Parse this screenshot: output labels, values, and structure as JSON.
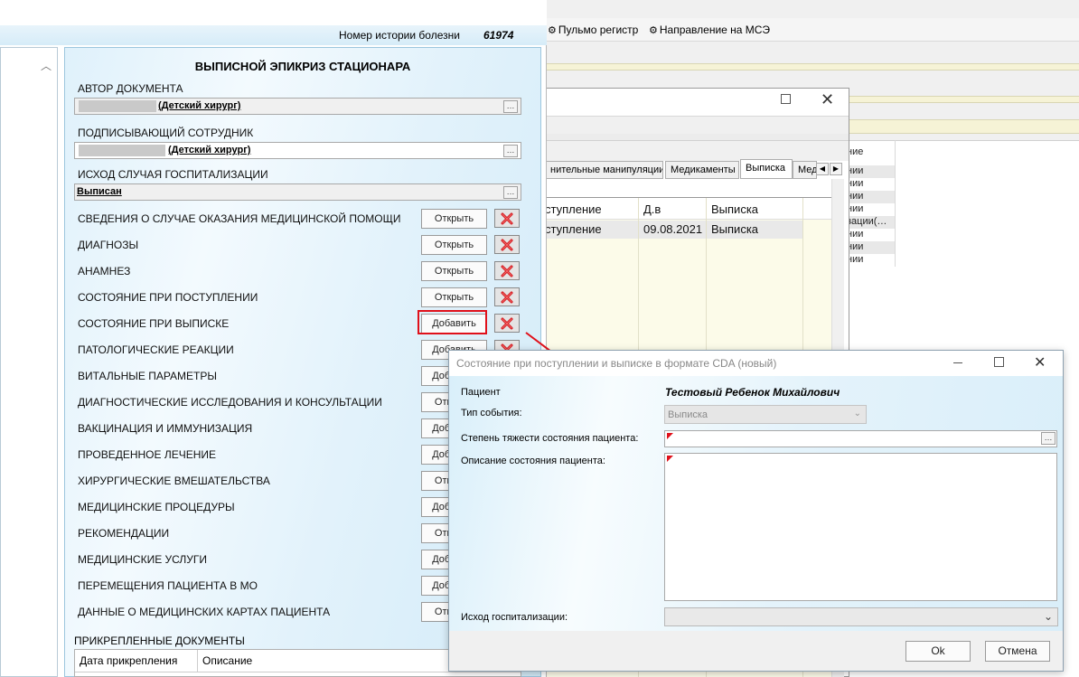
{
  "toolbar": {
    "pulmo_label": "Пульмо регистр",
    "mse_label": "Направление на МСЭ"
  },
  "epicrisis": {
    "history_label": "Номер истории болезни",
    "history_number": "61974",
    "title": "ВЫПИСНОЙ ЭПИКРИЗ СТАЦИОНАРА",
    "author_label": "АВТОР ДОКУМЕНТА",
    "author_value": "(Детский хирург)",
    "signer_label": "ПОДПИСЫВАЮЩИЙ СОТРУДНИК",
    "signer_value": "(Детский хирург)",
    "outcome_label": "ИСХОД СЛУЧАЯ ГОСПИТАЛИЗАЦИИ",
    "outcome_value": "Выписан",
    "sections": [
      {
        "label": "СВЕДЕНИЯ О СЛУЧАЕ ОКАЗАНИЯ МЕДИЦИНСКОЙ ПОМОЩИ",
        "button": "Открыть"
      },
      {
        "label": "ДИАГНОЗЫ",
        "button": "Открыть"
      },
      {
        "label": "АНАМНЕЗ",
        "button": "Открыть"
      },
      {
        "label": "СОСТОЯНИЕ ПРИ ПОСТУПЛЕНИИ",
        "button": "Открыть"
      },
      {
        "label": "СОСТОЯНИЕ ПРИ ВЫПИСКЕ",
        "button": "Добавить"
      },
      {
        "label": "ПАТОЛОГИЧЕСКИЕ РЕАКЦИИ",
        "button": "Добавить"
      },
      {
        "label": "ВИТАЛЬНЫЕ ПАРАМЕТРЫ",
        "button": "Добавить"
      },
      {
        "label": "ДИАГНОСТИЧЕСКИЕ ИССЛЕДОВАНИЯ И КОНСУЛЬТАЦИИ",
        "button": "Открыть"
      },
      {
        "label": "ВАКЦИНАЦИЯ И ИММУНИЗАЦИЯ",
        "button": "Добавить"
      },
      {
        "label": "ПРОВЕДЕННОЕ ЛЕЧЕНИЕ",
        "button": "Добавить"
      },
      {
        "label": "ХИРУРГИЧЕСКИЕ ВМЕШАТЕЛЬСТВА",
        "button": "Открыть"
      },
      {
        "label": "МЕДИЦИНСКИЕ ПРОЦЕДУРЫ",
        "button": "Добавить"
      },
      {
        "label": "РЕКОМЕНДАЦИИ",
        "button": "Открыть"
      },
      {
        "label": "МЕДИЦИНСКИЕ УСЛУГИ",
        "button": "Добавить"
      },
      {
        "label": "ПЕРЕМЕЩЕНИЯ ПАЦИЕНТА В МО",
        "button": "Добавить"
      },
      {
        "label": "ДАННЫЕ О МЕДИЦИНСКИХ КАРТАХ ПАЦИЕНТА",
        "button": "Открыть"
      }
    ],
    "attached_label": "ПРИКРЕПЛЕННЫЕ ДОКУМЕНТЫ",
    "attached_columns": [
      "Дата прикрепления",
      "Описание"
    ]
  },
  "middle_window": {
    "tabs": [
      "нительные манипуляции",
      "Медикаменты",
      "Выписка",
      "Мед"
    ],
    "columns": [
      "ступление",
      "Д.в",
      "Выписка"
    ],
    "row": [
      "ступление",
      "09.08.2021",
      "Выписка"
    ]
  },
  "right_list": {
    "header": "ние",
    "items": [
      "нии",
      "нии",
      "нии",
      "нии",
      "зации(…",
      "нии",
      "нии",
      "нии"
    ]
  },
  "dialog": {
    "title": "Состояние при поступлении и выписке в формате CDA (новый)",
    "patient_label": "Пациент",
    "patient_name": "Тестовый Ребенок Михайлович",
    "event_type_label": "Тип события:",
    "event_type_value": "Выписка",
    "severity_label": "Степень тяжести состояния пациента:",
    "description_label": "Описание состояния пациента:",
    "outcome_label": "Исход госпитализации:",
    "ok_label": "Ok",
    "cancel_label": "Отмена"
  }
}
